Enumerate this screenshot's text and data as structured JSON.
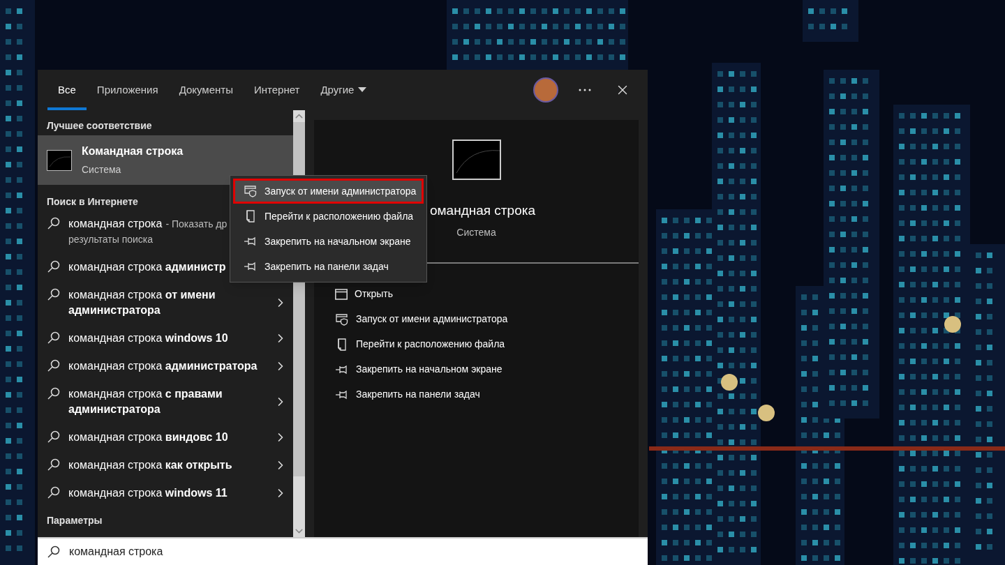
{
  "tabs": [
    {
      "label": "Все",
      "selected": true,
      "dropdown": false
    },
    {
      "label": "Приложения",
      "selected": false,
      "dropdown": false
    },
    {
      "label": "Документы",
      "selected": false,
      "dropdown": false
    },
    {
      "label": "Интернет",
      "selected": false,
      "dropdown": false
    },
    {
      "label": "Другие",
      "selected": false,
      "dropdown": true
    }
  ],
  "best_match": {
    "heading": "Лучшее соответствие",
    "title": "Командная строка",
    "subtitle": "Система",
    "selected": true
  },
  "web_search": {
    "heading": "Поиск в Интернете",
    "results": [
      {
        "text": "командная строка",
        "note": "- Показать др",
        "note_line_2": "результаты поиска"
      },
      {
        "text": "командная строка **администр**"
      },
      {
        "text": "командная строка **от имени администратора**",
        "chevron": true
      },
      {
        "text": "командная строка **windows 10**",
        "chevron": true
      },
      {
        "text": "командная строка **администратора**",
        "chevron": true
      },
      {
        "text": "командная строка **с правами администратора**",
        "chevron": true
      },
      {
        "text": "командная строка **виндовс 10**",
        "chevron": true
      },
      {
        "text": "командная строка **как открыть**",
        "chevron": true
      },
      {
        "text": "командная строка **windows 11**",
        "chevron": true
      }
    ]
  },
  "settings_heading": "Параметры",
  "preview": {
    "title": "омандная строка",
    "subtitle": "Система",
    "actions": [
      {
        "kind": "open",
        "label": "Открыть"
      },
      {
        "kind": "admin",
        "label": "Запуск от имени администратора"
      },
      {
        "kind": "location",
        "label": "Перейти к расположению файла"
      },
      {
        "kind": "pin",
        "label": "Закрепить на начальном экране"
      },
      {
        "kind": "pin",
        "label": "Закрепить на панели задач"
      }
    ]
  },
  "context_menu": [
    {
      "kind": "admin",
      "label": "Запуск от имени администратора",
      "selected": true,
      "highlighted": true
    },
    {
      "kind": "location",
      "label": "Перейти к расположению файла",
      "selected": false,
      "highlighted": false
    },
    {
      "kind": "pin",
      "label": "Закрепить на начальном экране",
      "selected": false,
      "highlighted": false
    },
    {
      "kind": "pin",
      "label": "Закрепить на панели задач",
      "selected": false,
      "highlighted": false
    }
  ],
  "search": {
    "value": "командная строка"
  }
}
